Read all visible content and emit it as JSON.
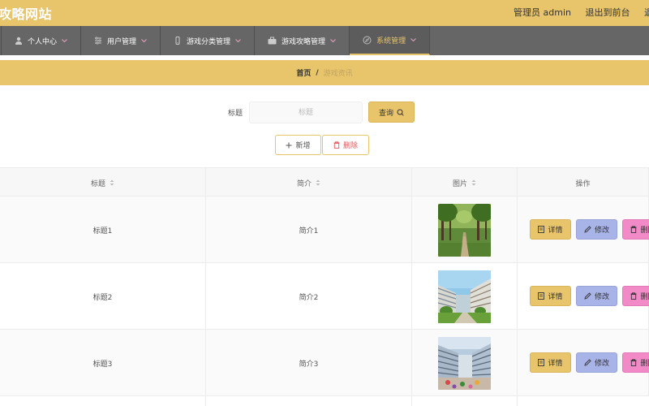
{
  "header": {
    "site_title": "攻略网站",
    "admin_label": "管理员 admin",
    "back_front": "退出到前台",
    "logout": "退出"
  },
  "nav": {
    "items": [
      {
        "label": "个人中心",
        "icon": "person-icon"
      },
      {
        "label": "用户管理",
        "icon": "sliders-icon"
      },
      {
        "label": "游戏分类管理",
        "icon": "phone-icon"
      },
      {
        "label": "游戏攻略管理",
        "icon": "briefcase-icon"
      },
      {
        "label": "系统管理",
        "icon": "compass-icon",
        "active": true
      }
    ]
  },
  "breadcrumb": {
    "home": "首页",
    "separator": "/",
    "current": "游戏资讯"
  },
  "search": {
    "label": "标题",
    "placeholder": "标题",
    "query_button": "查询"
  },
  "actions": {
    "add": "新增",
    "delete": "删除"
  },
  "table": {
    "headers": [
      "标题",
      "简介",
      "图片",
      "操作"
    ],
    "rows": [
      {
        "title": "标题1",
        "intro": "简介1",
        "image": "park-trees"
      },
      {
        "title": "标题2",
        "intro": "简介2",
        "image": "campus-courtyard"
      },
      {
        "title": "标题3",
        "intro": "简介3",
        "image": "campus-building"
      }
    ],
    "row_actions": {
      "detail": "详情",
      "edit": "修改",
      "remove": "删除"
    }
  },
  "colors": {
    "accent": "#e8c56b",
    "nav_bg": "#666666",
    "edit": "#a8b3e8",
    "remove": "#f28ac7"
  }
}
